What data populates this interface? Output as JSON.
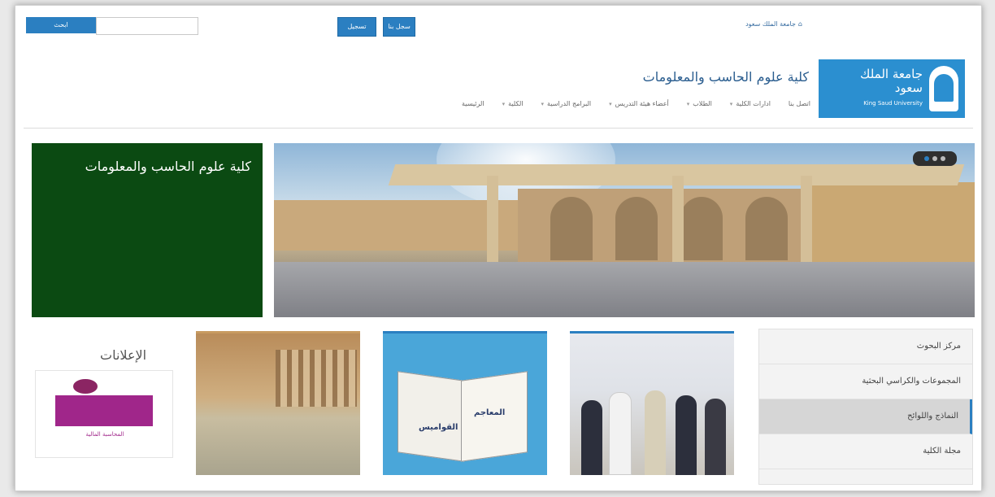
{
  "topbar": {
    "search_button": "ابحث",
    "search_placeholder": "",
    "register_button": "سجل بنا",
    "login_button": "تسجيل",
    "home_link": "جامعة الملك سعود"
  },
  "logo": {
    "arabic": "جامعة الملك سعود",
    "english": "King Saud University"
  },
  "college": {
    "title": "كلية علوم الحاسب والمعلومات"
  },
  "nav": {
    "items": [
      {
        "label": "الرئيسية",
        "has_dropdown": false
      },
      {
        "label": "الكلية",
        "has_dropdown": true
      },
      {
        "label": "البرامج الدراسية",
        "has_dropdown": true
      },
      {
        "label": "أعضاء هيئة التدريس",
        "has_dropdown": true
      },
      {
        "label": "الطلاب",
        "has_dropdown": true
      },
      {
        "label": "ادارات الكلية",
        "has_dropdown": true
      },
      {
        "label": "اتصل بنا",
        "has_dropdown": false
      }
    ]
  },
  "hero": {
    "green_title": "كلية علوم الحاسب والمعلومات",
    "slides_count": 3,
    "active_slide": 1
  },
  "sidebar": {
    "items": [
      {
        "label": "مركز البحوث",
        "active": false
      },
      {
        "label": "المجموعات والكراسي البحثية",
        "active": false
      },
      {
        "label": "النماذج واللوائح",
        "active": true
      },
      {
        "label": "مجلة الكلية",
        "active": false
      }
    ]
  },
  "cards": {
    "book_word1": "المعاجم",
    "book_word2": "القواميس"
  },
  "announcements": {
    "title": "الإعلانات",
    "caption": "المحاسبة المالية"
  },
  "colors": {
    "accent": "#2b7fc1",
    "green": "#0b4a12",
    "logo_blue": "#2b8fd0"
  }
}
